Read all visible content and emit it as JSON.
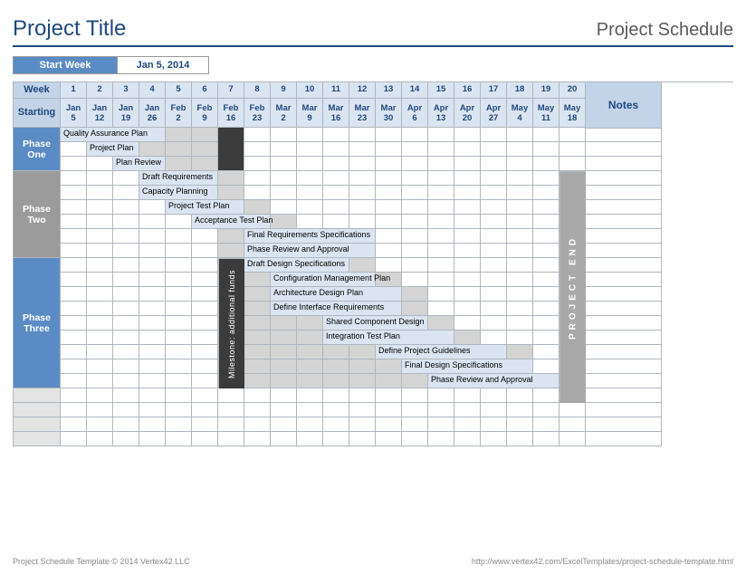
{
  "title": "Project Title",
  "subtitle": "Project Schedule",
  "start_week_label": "Start Week",
  "start_week_value": "Jan 5, 2014",
  "header": {
    "week_label": "Week",
    "starting_label": "Starting",
    "notes_label": "Notes",
    "weeks": [
      "1",
      "2",
      "3",
      "4",
      "5",
      "6",
      "7",
      "8",
      "9",
      "10",
      "11",
      "12",
      "13",
      "14",
      "15",
      "16",
      "17",
      "18",
      "19",
      "20"
    ],
    "dates": [
      {
        "m": "Jan",
        "d": "5"
      },
      {
        "m": "Jan",
        "d": "12"
      },
      {
        "m": "Jan",
        "d": "19"
      },
      {
        "m": "Jan",
        "d": "26"
      },
      {
        "m": "Feb",
        "d": "2"
      },
      {
        "m": "Feb",
        "d": "9"
      },
      {
        "m": "Feb",
        "d": "16"
      },
      {
        "m": "Feb",
        "d": "23"
      },
      {
        "m": "Mar",
        "d": "2"
      },
      {
        "m": "Mar",
        "d": "9"
      },
      {
        "m": "Mar",
        "d": "16"
      },
      {
        "m": "Mar",
        "d": "23"
      },
      {
        "m": "Mar",
        "d": "30"
      },
      {
        "m": "Apr",
        "d": "6"
      },
      {
        "m": "Apr",
        "d": "13"
      },
      {
        "m": "Apr",
        "d": "20"
      },
      {
        "m": "Apr",
        "d": "27"
      },
      {
        "m": "May",
        "d": "4"
      },
      {
        "m": "May",
        "d": "11"
      },
      {
        "m": "May",
        "d": "18"
      }
    ]
  },
  "milestone_label": "Milestone: additional funds",
  "project_end_label": "PROJECT END",
  "phases": {
    "one": "Phase\nOne",
    "two": "Phase\nTwo",
    "three": "Phase\nThree"
  },
  "footer": {
    "left": "Project Schedule Template © 2014 Vertex42 LLC",
    "right": "http://www.vertex42.com/ExcelTemplates/project-schedule-template.html"
  },
  "chart_data": {
    "type": "bar",
    "title": "Project Schedule",
    "xlabel": "Week Starting",
    "categories": [
      "Jan 5",
      "Jan 12",
      "Jan 19",
      "Jan 26",
      "Feb 2",
      "Feb 9",
      "Feb 16",
      "Feb 23",
      "Mar 2",
      "Mar 9",
      "Mar 16",
      "Mar 23",
      "Mar 30",
      "Apr 6",
      "Apr 13",
      "Apr 20",
      "Apr 27",
      "May 4",
      "May 11",
      "May 18"
    ],
    "tasks": [
      {
        "phase": "One",
        "name": "Quality Assurance Plan",
        "start": 1,
        "end": 6,
        "shade": [
          1,
          4
        ]
      },
      {
        "phase": "One",
        "name": "Project Plan",
        "start": 2,
        "end": 6,
        "shade": [
          2,
          3
        ]
      },
      {
        "phase": "One",
        "name": "Plan Review",
        "start": 3,
        "end": 6,
        "shade": [
          3,
          4
        ]
      },
      {
        "phase": "Two",
        "name": "Draft Requirements",
        "start": 4,
        "end": 7,
        "shade": [
          4,
          6
        ]
      },
      {
        "phase": "Two",
        "name": "Capacity Planning",
        "start": 4,
        "end": 7,
        "shade": [
          4,
          6
        ]
      },
      {
        "phase": "Two",
        "name": "Project Test Plan",
        "start": 5,
        "end": 8,
        "shade": [
          5,
          7
        ]
      },
      {
        "phase": "Two",
        "name": "Acceptance Test Plan",
        "start": 6,
        "end": 9,
        "shade": [
          6,
          8
        ]
      },
      {
        "phase": "Two",
        "name": "Final Requirements Specifications",
        "start": 7,
        "end": 12,
        "shade": [
          8,
          12
        ]
      },
      {
        "phase": "Two",
        "name": "Phase Review and Approval",
        "start": 7,
        "end": 12,
        "shade": [
          8,
          12
        ]
      },
      {
        "phase": "Three",
        "name": "Draft Design Specifications",
        "start": 8,
        "end": 12,
        "shade": [
          8,
          11
        ]
      },
      {
        "phase": "Three",
        "name": "Configuration Management Plan",
        "start": 8,
        "end": 13,
        "shade": [
          9,
          12
        ]
      },
      {
        "phase": "Three",
        "name": "Architecture Design Plan",
        "start": 8,
        "end": 14,
        "shade": [
          9,
          13
        ]
      },
      {
        "phase": "Three",
        "name": "Define Interface Requirements",
        "start": 8,
        "end": 14,
        "shade": [
          9,
          13
        ]
      },
      {
        "phase": "Three",
        "name": "Shared Component Design",
        "start": 8,
        "end": 15,
        "shade": [
          11,
          14
        ]
      },
      {
        "phase": "Three",
        "name": "Integration Test Plan",
        "start": 8,
        "end": 16,
        "shade": [
          11,
          15
        ]
      },
      {
        "phase": "Three",
        "name": "Define Project Guidelines",
        "start": 8,
        "end": 18,
        "shade": [
          13,
          17
        ]
      },
      {
        "phase": "Three",
        "name": "Final Design Specifications",
        "start": 8,
        "end": 18,
        "shade": [
          14,
          18
        ]
      },
      {
        "phase": "Three",
        "name": "Phase Review and Approval",
        "start": 8,
        "end": 19,
        "shade": [
          15,
          19
        ]
      }
    ],
    "milestone": {
      "name": "Milestone: additional funds",
      "week": 7
    },
    "project_end_week": 20
  }
}
